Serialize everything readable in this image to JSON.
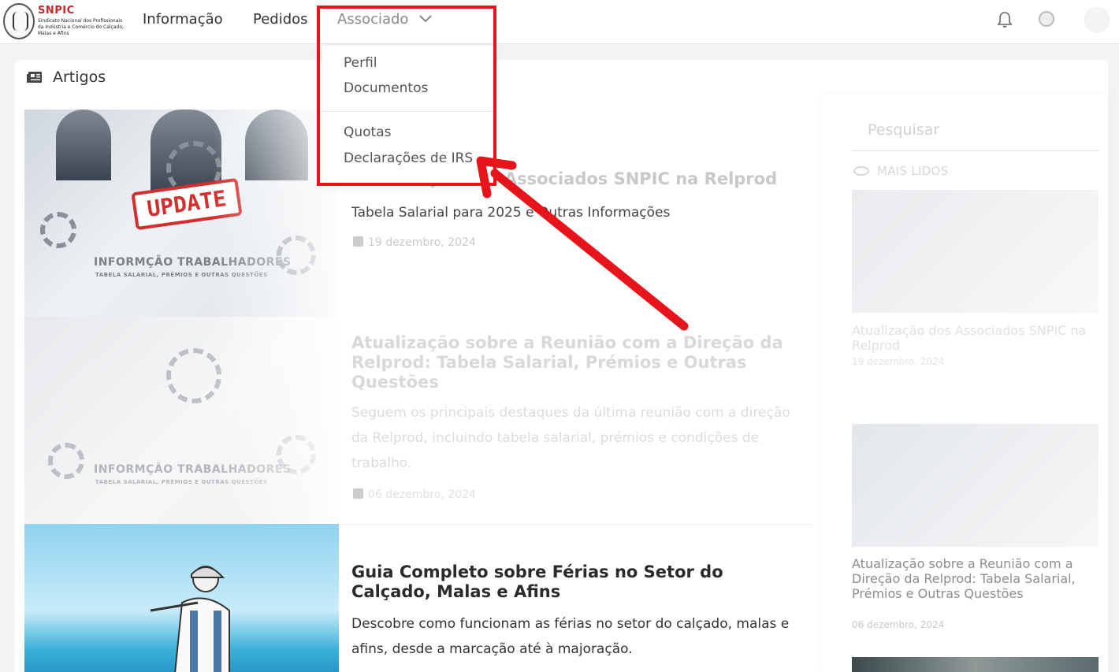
{
  "brand": {
    "name": "SNPIC",
    "subtitle": "Sindicato Nacional dos Profissionais da Indústria e Comércio do Calçado, Malas e Afins"
  },
  "nav": {
    "info": "Informação",
    "pedidos": "Pedidos",
    "associado": "Associado"
  },
  "dropdown": {
    "perfil": "Perfil",
    "documentos": "Documentos",
    "quotas": "Quotas",
    "irs": "Declarações de IRS"
  },
  "section": {
    "title": "Artigos"
  },
  "articles": [
    {
      "title": "Atualização dos Associados SNPIC na Relprod",
      "desc": "Tabela Salarial para 2025 e Outras Informações",
      "date": "19 dezembro, 2024",
      "image_caption": "INFORMÇÃO TRABALHADORES",
      "image_subcaption": "TABELA SALARIAL, PRÉMIOS E OUTRAS QUESTÕES",
      "stamp": "UPDATE"
    },
    {
      "title": "Atualização sobre a Reunião com a Direção da Relprod: Tabela Salarial, Prémios e Outras Questões",
      "desc": "Seguem os principais destaques da última reunião com a direção da Relprod, incluindo tabela salarial, prémios e condições de trabalho.",
      "date": "06 dezembro, 2024",
      "image_caption": "INFORMÇÃO TRABALHADORES",
      "image_subcaption": "TABELA SALARIAL, PRÉMIOS E OUTRAS QUESTÕES"
    },
    {
      "title": "Guia Completo sobre Férias no Setor do Calçado, Malas e Afins",
      "desc": "Descobre como funcionam as férias no setor do calçado, malas e afins, desde a marcação até à majoração."
    }
  ],
  "sidebar": {
    "search_placeholder": "Pesquisar",
    "most_read": "MAIS LIDOS",
    "items": [
      {
        "title": "Atualização dos Associados SNPIC na Relprod",
        "date": "19 dezembro, 2024"
      },
      {
        "title": "Atualização sobre a Reunião com a Direção da Relprod: Tabela Salarial, Prémios e Outras Questões",
        "date": "06 dezembro, 2024"
      }
    ]
  },
  "colors": {
    "brand_red": "#c62828",
    "annotation_red": "#e8141b"
  }
}
